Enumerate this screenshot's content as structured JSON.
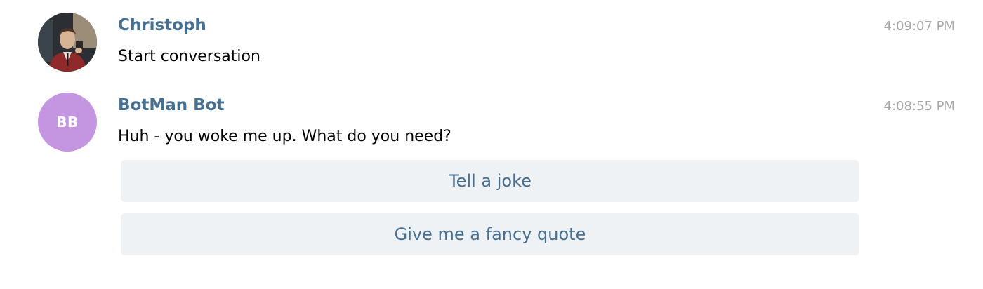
{
  "messages": [
    {
      "author": "Christoph",
      "text": "Start conversation",
      "time": "4:09:07 PM",
      "avatar": {
        "type": "photo",
        "icon": "user-photo-avatar"
      }
    },
    {
      "author": "BotMan Bot",
      "text": "Huh - you woke me up. What do you need?",
      "time": "4:08:55 PM",
      "avatar": {
        "type": "initials",
        "initials": "BB",
        "color": "#c495e0"
      },
      "buttons": [
        {
          "label": "Tell a joke"
        },
        {
          "label": "Give me a fancy quote"
        }
      ]
    }
  ],
  "colors": {
    "author": "#456f93",
    "timestamp": "#a5a7aa",
    "button_bg": "#eff2f5",
    "button_text": "#456f93"
  }
}
